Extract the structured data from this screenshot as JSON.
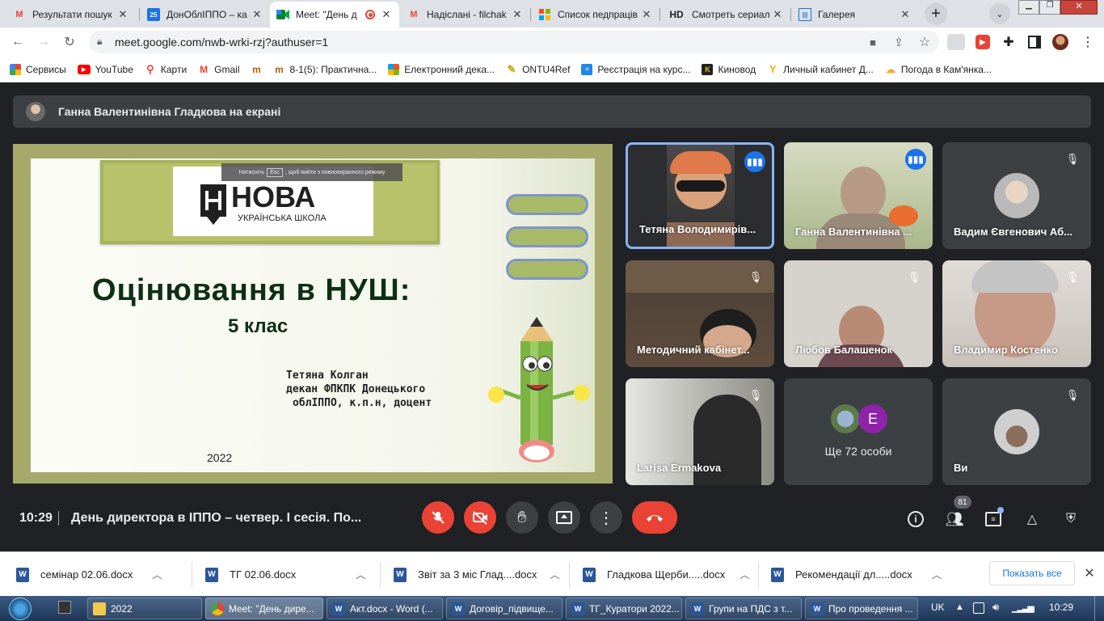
{
  "browser": {
    "tabs": [
      {
        "title": "Результати пошук",
        "favicon": "gmail-icon"
      },
      {
        "title": "ДонОблІППО – ка",
        "favicon": "calendar-icon"
      },
      {
        "title": "Meet: \"День д",
        "favicon": "meet-icon",
        "active": true
      },
      {
        "title": "Надіслані - filchak",
        "favicon": "gmail-icon"
      },
      {
        "title": "Список педпраців",
        "favicon": "sheets-icon"
      },
      {
        "title": "Смотреть сериал",
        "favicon": "hd-icon",
        "badge": "HD"
      },
      {
        "title": "Галерея",
        "favicon": "gallery-icon"
      }
    ],
    "url": "meet.google.com/nwb-wrki-rzj?authuser=1",
    "bookmarks": [
      {
        "label": "Сервисы",
        "icon": "apps-icon"
      },
      {
        "label": "YouTube",
        "icon": "youtube-icon"
      },
      {
        "label": "Карти",
        "icon": "maps-icon"
      },
      {
        "label": "Gmail",
        "icon": "gmail-icon"
      },
      {
        "label": "",
        "icon": "edu-icon"
      },
      {
        "label": "8-1(5): Практична...",
        "icon": "edu-icon"
      },
      {
        "label": "Електронний дека...",
        "icon": "windows-icon"
      },
      {
        "label": "ONTU4Ref",
        "icon": "pencil-icon"
      },
      {
        "label": "Реєстрація на курс...",
        "icon": "reg-icon"
      },
      {
        "label": "Киновод",
        "icon": "kinovod-icon"
      },
      {
        "label": "Личный кабинет Д...",
        "icon": "cabinet-icon"
      },
      {
        "label": "Погода в Кам'янка...",
        "icon": "weather-icon"
      }
    ]
  },
  "meet": {
    "presenter_banner": "Ганна Валентинівна Гладкова на екрані",
    "slide": {
      "esc_hint_before": "Натисніть",
      "esc_key": "Esc",
      "esc_hint_after": ", щоб вийти з повноекранного режиму",
      "logo_main": "НОВА",
      "logo_sub": "УКРАЇНСЬКА ШКОЛА",
      "title": "Оцінювання в НУШ:",
      "subtitle": "5 клас",
      "author_line1": "Тетяна Колган",
      "author_line2": "декан ФПКПК Донецького",
      "author_line3": "облІППО, к.п.н, доцент",
      "year": "2022"
    },
    "participants": [
      {
        "name": "Тетяна Володимирів...",
        "state": "speaking"
      },
      {
        "name": "Ганна Валентинівна ...",
        "state": "speaking"
      },
      {
        "name": "Вадим Євгенович Аб...",
        "state": "muted"
      },
      {
        "name": "Методичний кабінет...",
        "state": "muted"
      },
      {
        "name": "Любов Балашенок",
        "state": "muted"
      },
      {
        "name": "Владимир Костенко",
        "state": "muted"
      },
      {
        "name": "Larisa Ermakova",
        "state": "muted"
      },
      {
        "name": "Ще 72 особи",
        "avatar_letter": "E"
      },
      {
        "name": "Ви",
        "state": "muted"
      }
    ],
    "time": "10:29",
    "meeting_title": "День директора в ІППО – четвер. І сесія. По...",
    "people_count": "81"
  },
  "downloads": {
    "items": [
      "семінар 02.06.docx",
      "ТГ 02.06.docx",
      "Звіт за 3 міс Глад....docx",
      "Гладкова Щерби.....docx",
      "Рекомендації дл.....docx"
    ],
    "show_all": "Показать все"
  },
  "taskbar": {
    "items": [
      "2022",
      "Meet: \"День дире...",
      "Акт.docx - Word (...",
      "Договір_підвище...",
      "ТГ_Куратори 2022...",
      "Групи на ПДС з т...",
      "Про проведення ..."
    ],
    "lang": "UK",
    "clock": "10:29"
  },
  "colors": {
    "accent": "#1a73e8",
    "danger": "#ea4335",
    "slide_title": "#0d2f16"
  }
}
